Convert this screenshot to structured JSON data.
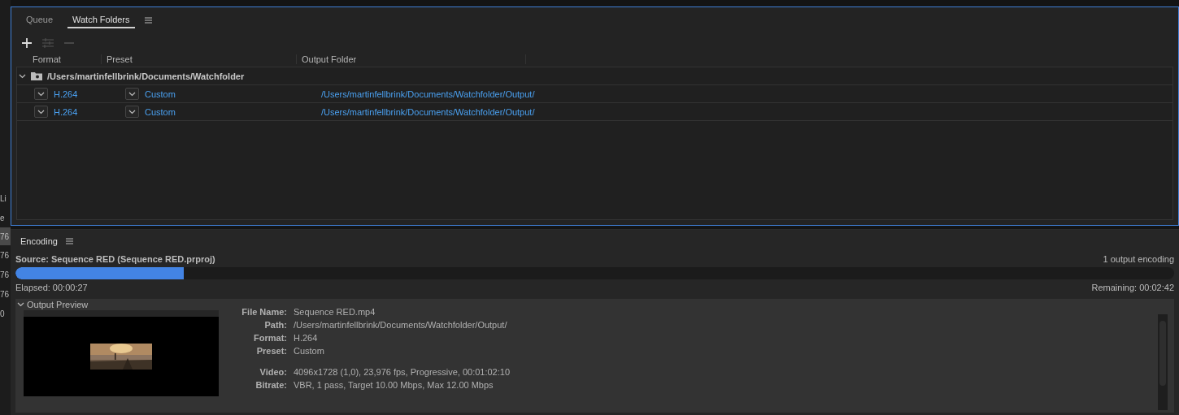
{
  "side_panel": {
    "items": [
      {
        "text": "Li",
        "selected": false
      },
      {
        "text": "e",
        "selected": false
      },
      {
        "text": "76",
        "selected": true
      },
      {
        "text": "76",
        "selected": false
      },
      {
        "text": "76",
        "selected": false
      },
      {
        "text": "76",
        "selected": false
      },
      {
        "text": "0",
        "selected": false
      }
    ]
  },
  "tabs": [
    {
      "label": "Queue",
      "selected": false
    },
    {
      "label": "Watch Folders",
      "selected": true
    }
  ],
  "toolbar": [
    {
      "kind": "add",
      "disabled": false
    },
    {
      "kind": "settings",
      "disabled": true
    },
    {
      "kind": "remove",
      "disabled": true
    }
  ],
  "table": {
    "columns": [
      "Format",
      "Preset",
      "Output Folder"
    ],
    "folders": [
      {
        "path": "/Users/martinfellbrink/Documents/Watchfolder",
        "expanded": true,
        "children": [
          {
            "format": "H.264",
            "preset": "Custom",
            "output": "/Users/martinfellbrink/Documents/Watchfolder/Output/"
          },
          {
            "format": "H.264",
            "preset": "Custom",
            "output": "/Users/martinfellbrink/Documents/Watchfolder/Output/"
          }
        ]
      }
    ]
  },
  "encoding": {
    "title": "Encoding",
    "source": "Source: Sequence RED (Sequence RED.prproj)",
    "count": "1 output encoding",
    "level": 0.145,
    "elapsed": "Elapsed: 00:00:27",
    "remaining": "Remaining: 00:02:42",
    "preview": {
      "title": "Output Preview",
      "expanded": true,
      "details": [
        {
          "label": "File Name:",
          "value": "Sequence RED.mp4"
        },
        {
          "label": "Path:",
          "value": "/Users/martinfellbrink/Documents/Watchfolder/Output/"
        },
        {
          "label": "Format:",
          "value": "H.264"
        },
        {
          "label": "Preset:",
          "value": "Custom"
        },
        {
          "label": "Video:",
          "value": "4096x1728 (1,0), 23,976 fps, Progressive, 00:01:02:10",
          "gap": true
        },
        {
          "label": "Bitrate:",
          "value": "VBR, 1 pass, Target 10.00 Mbps, Max 12.00 Mbps"
        }
      ]
    }
  }
}
